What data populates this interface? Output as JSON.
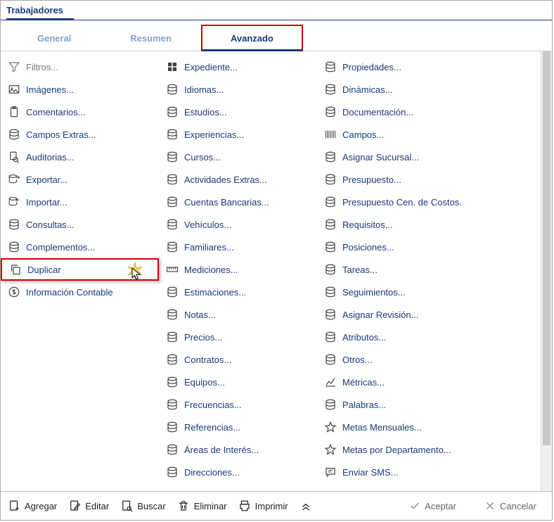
{
  "title": "Trabajadores",
  "tabs": {
    "general": "General",
    "resumen": "Resumen",
    "avanzado": "Avanzado"
  },
  "col1": {
    "filtros": "Filtros...",
    "imagenes": "Imágenes...",
    "comentarios": "Comentarios...",
    "campos_extras": "Campos Extras...",
    "auditorias": "Auditorias...",
    "exportar": "Exportar...",
    "importar": "Importar...",
    "consultas": "Consultas...",
    "complementos": "Complementos...",
    "duplicar": "Duplicar",
    "info_contable": "Información Contable"
  },
  "col2": {
    "expediente": "Expediente...",
    "idiomas": "Idiomas...",
    "estudios": "Estudios...",
    "experiencias": "Experiencias...",
    "cursos": "Cursos...",
    "actividades": "Actividades Extras...",
    "cuentas": "Cuentas Bancarias...",
    "vehiculos": "Vehículos...",
    "familiares": "Familiares...",
    "mediciones": "Mediciones...",
    "estimaciones": "Estimaciones...",
    "notas": "Notas...",
    "precios": "Precios...",
    "contratos": "Contratos...",
    "equipos": "Equipos...",
    "frecuencias": "Frecuencias...",
    "referencias": "Referencias...",
    "areas": "Áreas de Interés...",
    "direcciones": "Direcciones..."
  },
  "col3": {
    "propiedades": "Propiedades...",
    "dinamicas": "Dinámicas...",
    "documentacion": "Documentación...",
    "campos": "Campos...",
    "asignar_sucursal": "Asignar Sucursal...",
    "presupuesto": "Presupuesto...",
    "presupuesto_cc": "Presupuesto Cen. de Costos.",
    "requisitos": "Requisitos...",
    "posiciones": "Posiciones...",
    "tareas": "Tareas...",
    "seguimientos": "Seguimientos...",
    "asignar_revision": "Asignar Revisión...",
    "atributos": "Atributos...",
    "otros": "Otros...",
    "metricas": "Métricas...",
    "palabras": "Palabras...",
    "metas_mensuales": "Metas Mensuales...",
    "metas_depto": "Metas por Departamento...",
    "enviar_sms": "Enviar SMS..."
  },
  "footer": {
    "agregar": "Agregar",
    "editar": "Editar",
    "buscar": "Buscar",
    "eliminar": "Eliminar",
    "imprimir": "Imprimir",
    "aceptar": "Aceptar",
    "cancelar": "Cancelar"
  }
}
